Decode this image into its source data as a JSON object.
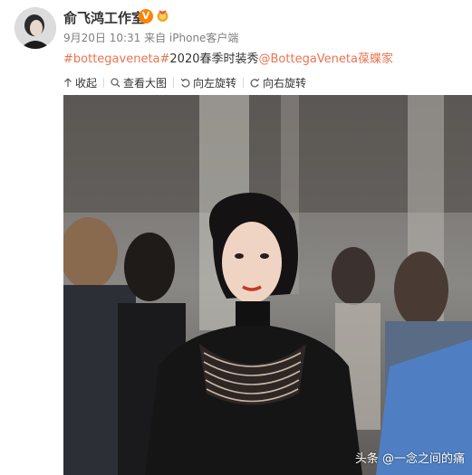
{
  "post": {
    "username": "俞飞鸿工作室",
    "verified_badge": "V",
    "meta": "9月20日 10:31 来自 iPhone客户端",
    "content": {
      "hashtag": "#bottegaveneta#",
      "text": "2020春季时装秀",
      "mention": "@BottegaVeneta葆蝶家"
    }
  },
  "toolbar": {
    "collapse": "收起",
    "view_large": "查看大图",
    "rotate_left": "向左旋转",
    "rotate_right": "向右旋转"
  },
  "watermark": "头条 @一念之间的痛",
  "colors": {
    "link": "#eb7350",
    "badge": "#ff8200",
    "meta": "#808080"
  }
}
